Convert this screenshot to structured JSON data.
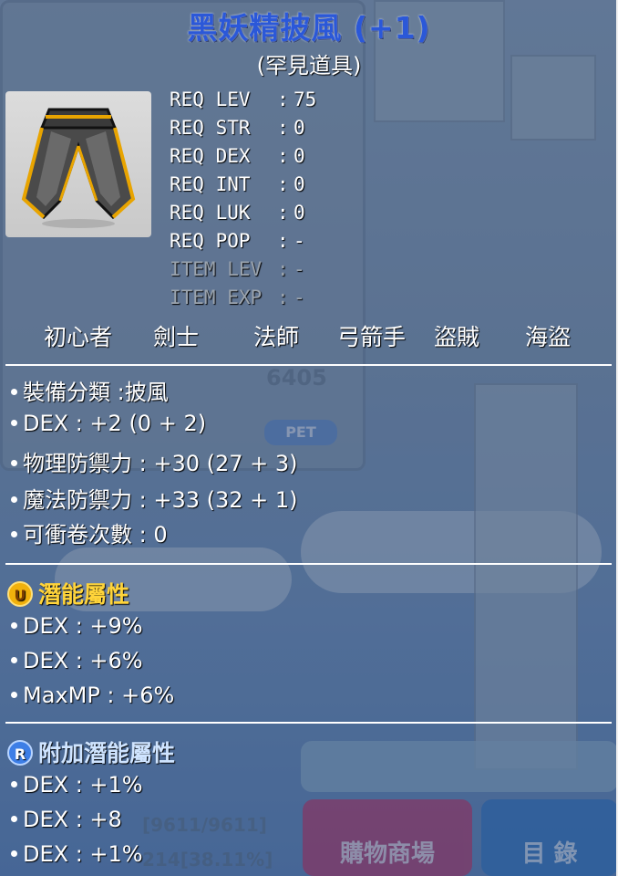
{
  "item": {
    "name": "黑妖精披風 (+1)",
    "rarity": "(罕見道具)",
    "icon": "cape-icon"
  },
  "requirements": [
    {
      "label": "REQ LEV",
      "value": "75"
    },
    {
      "label": "REQ STR",
      "value": "0"
    },
    {
      "label": "REQ DEX",
      "value": "0"
    },
    {
      "label": "REQ INT",
      "value": "0"
    },
    {
      "label": "REQ LUK",
      "value": "0"
    },
    {
      "label": "REQ POP",
      "value": "-"
    },
    {
      "label": "ITEM LEV",
      "value": "-"
    },
    {
      "label": "ITEM EXP",
      "value": "-"
    }
  ],
  "jobs": [
    "初心者",
    "劍士",
    "法師",
    "弓箭手",
    "盜賊",
    "海盜"
  ],
  "stats": [
    "裝備分類 :披風",
    "DEX : +2 (0 + 2)",
    "物理防禦力 : +30 (27 + 3)",
    "魔法防禦力 : +33 (32 + 1)",
    "可衝卷次數 : 0"
  ],
  "potential": {
    "icon_letter": "U",
    "title": "潛能屬性",
    "lines": [
      "DEX : +9%",
      "DEX : +6%",
      "MaxMP : +6%"
    ]
  },
  "bonus_potential": {
    "icon_letter": "R",
    "title": "附加潛能屬性",
    "lines": [
      "DEX : +1%",
      "DEX : +8",
      "DEX : +1%"
    ]
  },
  "background": {
    "pet_button": "PET",
    "pet_count": "6405",
    "hp_readout": "[9611/9611]",
    "exp_readout": "214[38.11%]",
    "cash_shop": "購物商場",
    "menu": "目 錄"
  },
  "colors": {
    "title": "#2b58d8",
    "potential_header": "#ffd43a",
    "bonus_potential_icon": "#3d7ee6",
    "dim_text": "#9aa3ad"
  }
}
